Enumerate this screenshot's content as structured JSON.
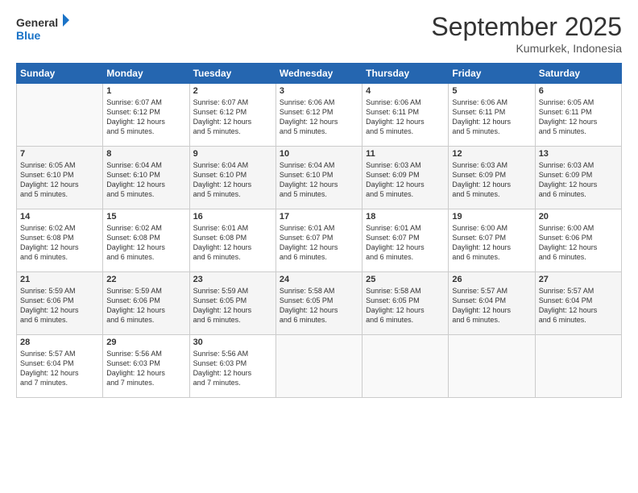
{
  "logo": {
    "line1": "General",
    "line2": "Blue"
  },
  "title": "September 2025",
  "location": "Kumurkek, Indonesia",
  "days_header": [
    "Sunday",
    "Monday",
    "Tuesday",
    "Wednesday",
    "Thursday",
    "Friday",
    "Saturday"
  ],
  "weeks": [
    [
      {
        "day": "",
        "info": ""
      },
      {
        "day": "1",
        "info": "Sunrise: 6:07 AM\nSunset: 6:12 PM\nDaylight: 12 hours\nand 5 minutes."
      },
      {
        "day": "2",
        "info": "Sunrise: 6:07 AM\nSunset: 6:12 PM\nDaylight: 12 hours\nand 5 minutes."
      },
      {
        "day": "3",
        "info": "Sunrise: 6:06 AM\nSunset: 6:12 PM\nDaylight: 12 hours\nand 5 minutes."
      },
      {
        "day": "4",
        "info": "Sunrise: 6:06 AM\nSunset: 6:11 PM\nDaylight: 12 hours\nand 5 minutes."
      },
      {
        "day": "5",
        "info": "Sunrise: 6:06 AM\nSunset: 6:11 PM\nDaylight: 12 hours\nand 5 minutes."
      },
      {
        "day": "6",
        "info": "Sunrise: 6:05 AM\nSunset: 6:11 PM\nDaylight: 12 hours\nand 5 minutes."
      }
    ],
    [
      {
        "day": "7",
        "info": "Sunrise: 6:05 AM\nSunset: 6:10 PM\nDaylight: 12 hours\nand 5 minutes."
      },
      {
        "day": "8",
        "info": "Sunrise: 6:04 AM\nSunset: 6:10 PM\nDaylight: 12 hours\nand 5 minutes."
      },
      {
        "day": "9",
        "info": "Sunrise: 6:04 AM\nSunset: 6:10 PM\nDaylight: 12 hours\nand 5 minutes."
      },
      {
        "day": "10",
        "info": "Sunrise: 6:04 AM\nSunset: 6:10 PM\nDaylight: 12 hours\nand 5 minutes."
      },
      {
        "day": "11",
        "info": "Sunrise: 6:03 AM\nSunset: 6:09 PM\nDaylight: 12 hours\nand 5 minutes."
      },
      {
        "day": "12",
        "info": "Sunrise: 6:03 AM\nSunset: 6:09 PM\nDaylight: 12 hours\nand 5 minutes."
      },
      {
        "day": "13",
        "info": "Sunrise: 6:03 AM\nSunset: 6:09 PM\nDaylight: 12 hours\nand 6 minutes."
      }
    ],
    [
      {
        "day": "14",
        "info": "Sunrise: 6:02 AM\nSunset: 6:08 PM\nDaylight: 12 hours\nand 6 minutes."
      },
      {
        "day": "15",
        "info": "Sunrise: 6:02 AM\nSunset: 6:08 PM\nDaylight: 12 hours\nand 6 minutes."
      },
      {
        "day": "16",
        "info": "Sunrise: 6:01 AM\nSunset: 6:08 PM\nDaylight: 12 hours\nand 6 minutes."
      },
      {
        "day": "17",
        "info": "Sunrise: 6:01 AM\nSunset: 6:07 PM\nDaylight: 12 hours\nand 6 minutes."
      },
      {
        "day": "18",
        "info": "Sunrise: 6:01 AM\nSunset: 6:07 PM\nDaylight: 12 hours\nand 6 minutes."
      },
      {
        "day": "19",
        "info": "Sunrise: 6:00 AM\nSunset: 6:07 PM\nDaylight: 12 hours\nand 6 minutes."
      },
      {
        "day": "20",
        "info": "Sunrise: 6:00 AM\nSunset: 6:06 PM\nDaylight: 12 hours\nand 6 minutes."
      }
    ],
    [
      {
        "day": "21",
        "info": "Sunrise: 5:59 AM\nSunset: 6:06 PM\nDaylight: 12 hours\nand 6 minutes."
      },
      {
        "day": "22",
        "info": "Sunrise: 5:59 AM\nSunset: 6:06 PM\nDaylight: 12 hours\nand 6 minutes."
      },
      {
        "day": "23",
        "info": "Sunrise: 5:59 AM\nSunset: 6:05 PM\nDaylight: 12 hours\nand 6 minutes."
      },
      {
        "day": "24",
        "info": "Sunrise: 5:58 AM\nSunset: 6:05 PM\nDaylight: 12 hours\nand 6 minutes."
      },
      {
        "day": "25",
        "info": "Sunrise: 5:58 AM\nSunset: 6:05 PM\nDaylight: 12 hours\nand 6 minutes."
      },
      {
        "day": "26",
        "info": "Sunrise: 5:57 AM\nSunset: 6:04 PM\nDaylight: 12 hours\nand 6 minutes."
      },
      {
        "day": "27",
        "info": "Sunrise: 5:57 AM\nSunset: 6:04 PM\nDaylight: 12 hours\nand 6 minutes."
      }
    ],
    [
      {
        "day": "28",
        "info": "Sunrise: 5:57 AM\nSunset: 6:04 PM\nDaylight: 12 hours\nand 7 minutes."
      },
      {
        "day": "29",
        "info": "Sunrise: 5:56 AM\nSunset: 6:03 PM\nDaylight: 12 hours\nand 7 minutes."
      },
      {
        "day": "30",
        "info": "Sunrise: 5:56 AM\nSunset: 6:03 PM\nDaylight: 12 hours\nand 7 minutes."
      },
      {
        "day": "",
        "info": ""
      },
      {
        "day": "",
        "info": ""
      },
      {
        "day": "",
        "info": ""
      },
      {
        "day": "",
        "info": ""
      }
    ]
  ]
}
